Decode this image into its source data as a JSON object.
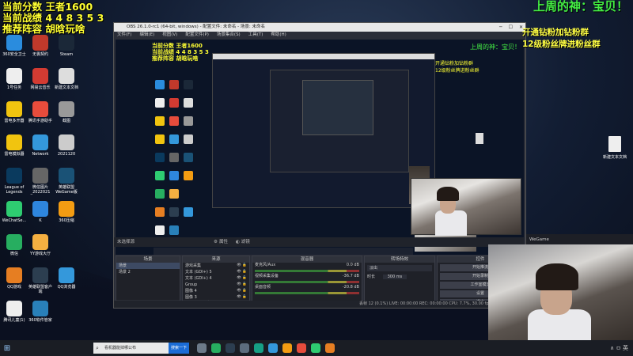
{
  "overlay": {
    "left_lines": [
      "当前分数 王者1600",
      "当前战绩 4 4 8 3 5 3",
      "推荐阵容 胡晗玩啥"
    ],
    "right_top": "上周的神：宝贝！",
    "right_lines": [
      "开通钻粉加钻粉群",
      "12级粉丝牌进粉丝群"
    ]
  },
  "desktop_icons": [
    {
      "label": "360安全卫士",
      "color": "#2a8cde"
    },
    {
      "label": "无畏契约",
      "color": "#c0392b"
    },
    {
      "label": "Steam",
      "color": "#1b2838"
    },
    {
      "label": "1号任务",
      "color": "#eeeeee"
    },
    {
      "label": "网易云音乐",
      "color": "#d33b32"
    },
    {
      "label": "新建文本文档",
      "color": "#dddddd"
    },
    {
      "label": "雷电多开器",
      "color": "#f1c40f"
    },
    {
      "label": "腾讯手游助手",
      "color": "#e74c3c"
    },
    {
      "label": "截图",
      "color": "#999999"
    },
    {
      "label": "雷电模拟器",
      "color": "#f1c40f"
    },
    {
      "label": "Network",
      "color": "#3498db"
    },
    {
      "label": "2021120",
      "color": "#cccccc"
    },
    {
      "label": "League of Legends",
      "color": "#0a3a5e"
    },
    {
      "label": "微信图片_2022021",
      "color": "#666666"
    },
    {
      "label": "英雄联盟WeGame版",
      "color": "#1a5276"
    },
    {
      "label": "WeChatSe...",
      "color": "#2ecc71"
    },
    {
      "label": "K",
      "color": "#2e86de"
    },
    {
      "label": "360压缩",
      "color": "#f39c12"
    },
    {
      "label": "微信",
      "color": "#27ae60"
    },
    {
      "label": "YY游戏大厅",
      "color": "#f5b041"
    },
    {
      "label": "",
      "color": "transparent"
    },
    {
      "label": "QQ游戏",
      "color": "#e67e22"
    },
    {
      "label": "英雄联盟客户端",
      "color": "#2c3e50"
    },
    {
      "label": "QQ浏览器",
      "color": "#3498db"
    },
    {
      "label": "腾讯儿童(1)",
      "color": "#eeeeee"
    },
    {
      "label": "360软件管家",
      "color": "#2980b9"
    }
  ],
  "right_desktop_icon": {
    "label": "新建文本文档"
  },
  "obs": {
    "title": "OBS 26.1.0-rc1 (64-bit, windows) - 配置文件: 未命名 - 场景: 未命名",
    "menu": [
      "文件(F)",
      "编辑(E)",
      "视图(V)",
      "配置文件(P)",
      "场景集合(S)",
      "工具(T)",
      "帮助(H)"
    ],
    "preview_toolbar": {
      "label": "未选择源",
      "props": "属性",
      "filters": "滤镜"
    },
    "docks": {
      "scenes": {
        "title": "场景",
        "items": [
          "场景",
          "场景 2"
        ]
      },
      "sources": {
        "title": "来源",
        "items": [
          "游戏采集",
          "文本 (GDI+) 5",
          "文本 (GDI+) 4",
          "Group",
          "图像 4",
          "图像 3"
        ]
      },
      "mixer": {
        "title": "混音器",
        "channels": [
          {
            "name": "麦克风/Aux",
            "level": "0.0 dB"
          },
          {
            "name": "视频采集设备",
            "level": "-36.7 dB"
          },
          {
            "name": "桌面音频",
            "level": "-20.8 dB"
          }
        ]
      },
      "transitions": {
        "title": "转场特效",
        "type": "淡出",
        "duration_label": "时长",
        "duration": "300 ms"
      },
      "controls": {
        "title": "控件",
        "buttons": [
          "开始推流",
          "开始录制",
          "工作室模式",
          "设置",
          "退出"
        ]
      }
    },
    "status": "丢帧 12 (0.1%)    LIVE: 00:00:00    REC: 00:00:00    CPU: 7.7%, 30.00 fps"
  },
  "edge_panel": {
    "label": "WeGame"
  },
  "taskbar": {
    "search_placeholder": "看机器能掉哪公布",
    "search_button": "搜索一下",
    "app_colors": [
      "#6c7a89",
      "#27ae60",
      "#2c3e50",
      "#5d6d7e",
      "#16a085",
      "#3498db",
      "#f39c12",
      "#e74c3c",
      "#2ecc71",
      "#e67e22"
    ],
    "right_text": "∧ ㅁ 英"
  }
}
